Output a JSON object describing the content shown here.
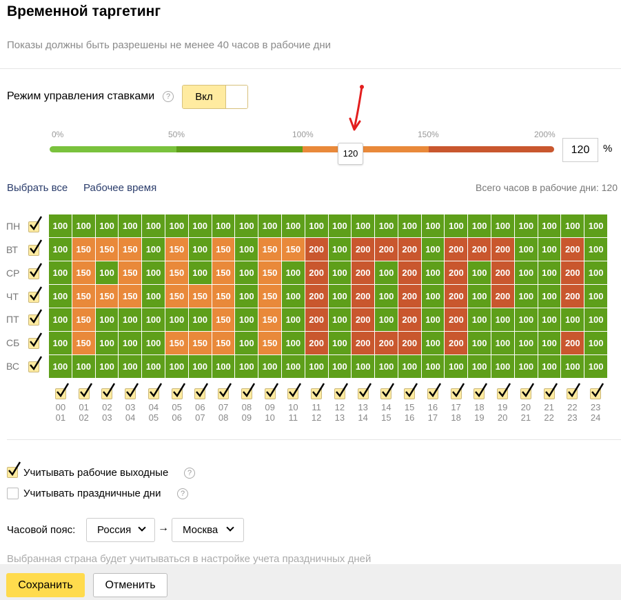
{
  "header": {
    "title": "Временной таргетинг",
    "subtitle": "Показы должны быть разрешены не менее 40 часов в рабочие дни"
  },
  "bid_mode": {
    "label": "Режим управления ставками",
    "help_icon": "question-circle-icon",
    "toggle_label": "Вкл",
    "enabled": true
  },
  "slider": {
    "ticks": [
      "0%",
      "50%",
      "100%",
      "150%",
      "200%"
    ],
    "value": "120",
    "input_value": "120",
    "unit": "%",
    "colors": {
      "0_50": "#7ac23d",
      "50_100": "#5e9f1a",
      "100_150": "#e9893a",
      "150_200": "#c9572e"
    }
  },
  "actions": {
    "select_all": "Выбрать все",
    "work_time": "Рабочее время",
    "total_hours": "Всего часов в рабочие дни: 120"
  },
  "days": [
    "ПН",
    "ВТ",
    "СР",
    "ЧТ",
    "ПТ",
    "СБ",
    "ВС"
  ],
  "hours": [
    [
      "00",
      "01"
    ],
    [
      "01",
      "02"
    ],
    [
      "02",
      "03"
    ],
    [
      "03",
      "04"
    ],
    [
      "04",
      "05"
    ],
    [
      "05",
      "06"
    ],
    [
      "06",
      "07"
    ],
    [
      "07",
      "08"
    ],
    [
      "08",
      "09"
    ],
    [
      "09",
      "10"
    ],
    [
      "10",
      "11"
    ],
    [
      "11",
      "12"
    ],
    [
      "12",
      "13"
    ],
    [
      "13",
      "14"
    ],
    [
      "14",
      "15"
    ],
    [
      "15",
      "16"
    ],
    [
      "16",
      "17"
    ],
    [
      "17",
      "18"
    ],
    [
      "18",
      "19"
    ],
    [
      "19",
      "20"
    ],
    [
      "20",
      "21"
    ],
    [
      "21",
      "22"
    ],
    [
      "22",
      "23"
    ],
    [
      "23",
      "24"
    ]
  ],
  "grid": [
    [
      100,
      100,
      100,
      100,
      100,
      100,
      100,
      100,
      100,
      100,
      100,
      100,
      100,
      100,
      100,
      100,
      100,
      100,
      100,
      100,
      100,
      100,
      100,
      100
    ],
    [
      100,
      150,
      150,
      150,
      100,
      150,
      100,
      150,
      100,
      150,
      150,
      200,
      100,
      200,
      200,
      200,
      100,
      200,
      200,
      200,
      100,
      100,
      200,
      100
    ],
    [
      100,
      150,
      100,
      150,
      100,
      150,
      100,
      150,
      100,
      150,
      100,
      200,
      100,
      200,
      100,
      200,
      100,
      200,
      100,
      200,
      100,
      100,
      200,
      100
    ],
    [
      100,
      150,
      150,
      150,
      100,
      150,
      150,
      150,
      100,
      150,
      100,
      200,
      100,
      200,
      100,
      200,
      100,
      200,
      100,
      200,
      100,
      100,
      200,
      100
    ],
    [
      100,
      150,
      100,
      100,
      100,
      100,
      100,
      150,
      100,
      150,
      100,
      200,
      100,
      200,
      100,
      200,
      100,
      200,
      100,
      100,
      100,
      100,
      100,
      100
    ],
    [
      100,
      150,
      100,
      100,
      100,
      150,
      150,
      150,
      100,
      150,
      100,
      200,
      100,
      200,
      200,
      200,
      100,
      200,
      100,
      100,
      100,
      100,
      200,
      100
    ],
    [
      100,
      100,
      100,
      100,
      100,
      100,
      100,
      100,
      100,
      100,
      100,
      100,
      100,
      100,
      100,
      100,
      100,
      100,
      100,
      100,
      100,
      100,
      100,
      100
    ]
  ],
  "options": {
    "working_weekends": {
      "label": "Учитывать рабочие выходные",
      "checked": true
    },
    "holidays": {
      "label": "Учитывать праздничные дни",
      "checked": false
    }
  },
  "timezone": {
    "label": "Часовой пояс:",
    "country": "Россия",
    "arrow": "→",
    "city": "Москва",
    "note": "Выбранная страна будет учитываться в настройке учета праздничных дней"
  },
  "footer": {
    "save": "Сохранить",
    "cancel": "Отменить"
  }
}
